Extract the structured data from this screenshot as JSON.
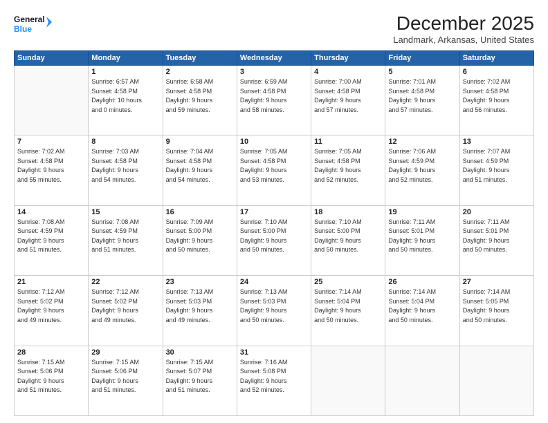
{
  "header": {
    "logo_line1": "General",
    "logo_line2": "Blue",
    "month": "December 2025",
    "location": "Landmark, Arkansas, United States"
  },
  "weekdays": [
    "Sunday",
    "Monday",
    "Tuesday",
    "Wednesday",
    "Thursday",
    "Friday",
    "Saturday"
  ],
  "weeks": [
    [
      {
        "day": "",
        "info": ""
      },
      {
        "day": "1",
        "info": "Sunrise: 6:57 AM\nSunset: 4:58 PM\nDaylight: 10 hours\nand 0 minutes."
      },
      {
        "day": "2",
        "info": "Sunrise: 6:58 AM\nSunset: 4:58 PM\nDaylight: 9 hours\nand 59 minutes."
      },
      {
        "day": "3",
        "info": "Sunrise: 6:59 AM\nSunset: 4:58 PM\nDaylight: 9 hours\nand 58 minutes."
      },
      {
        "day": "4",
        "info": "Sunrise: 7:00 AM\nSunset: 4:58 PM\nDaylight: 9 hours\nand 57 minutes."
      },
      {
        "day": "5",
        "info": "Sunrise: 7:01 AM\nSunset: 4:58 PM\nDaylight: 9 hours\nand 57 minutes."
      },
      {
        "day": "6",
        "info": "Sunrise: 7:02 AM\nSunset: 4:58 PM\nDaylight: 9 hours\nand 56 minutes."
      }
    ],
    [
      {
        "day": "7",
        "info": "Sunrise: 7:02 AM\nSunset: 4:58 PM\nDaylight: 9 hours\nand 55 minutes."
      },
      {
        "day": "8",
        "info": "Sunrise: 7:03 AM\nSunset: 4:58 PM\nDaylight: 9 hours\nand 54 minutes."
      },
      {
        "day": "9",
        "info": "Sunrise: 7:04 AM\nSunset: 4:58 PM\nDaylight: 9 hours\nand 54 minutes."
      },
      {
        "day": "10",
        "info": "Sunrise: 7:05 AM\nSunset: 4:58 PM\nDaylight: 9 hours\nand 53 minutes."
      },
      {
        "day": "11",
        "info": "Sunrise: 7:05 AM\nSunset: 4:58 PM\nDaylight: 9 hours\nand 52 minutes."
      },
      {
        "day": "12",
        "info": "Sunrise: 7:06 AM\nSunset: 4:59 PM\nDaylight: 9 hours\nand 52 minutes."
      },
      {
        "day": "13",
        "info": "Sunrise: 7:07 AM\nSunset: 4:59 PM\nDaylight: 9 hours\nand 51 minutes."
      }
    ],
    [
      {
        "day": "14",
        "info": "Sunrise: 7:08 AM\nSunset: 4:59 PM\nDaylight: 9 hours\nand 51 minutes."
      },
      {
        "day": "15",
        "info": "Sunrise: 7:08 AM\nSunset: 4:59 PM\nDaylight: 9 hours\nand 51 minutes."
      },
      {
        "day": "16",
        "info": "Sunrise: 7:09 AM\nSunset: 5:00 PM\nDaylight: 9 hours\nand 50 minutes."
      },
      {
        "day": "17",
        "info": "Sunrise: 7:10 AM\nSunset: 5:00 PM\nDaylight: 9 hours\nand 50 minutes."
      },
      {
        "day": "18",
        "info": "Sunrise: 7:10 AM\nSunset: 5:00 PM\nDaylight: 9 hours\nand 50 minutes."
      },
      {
        "day": "19",
        "info": "Sunrise: 7:11 AM\nSunset: 5:01 PM\nDaylight: 9 hours\nand 50 minutes."
      },
      {
        "day": "20",
        "info": "Sunrise: 7:11 AM\nSunset: 5:01 PM\nDaylight: 9 hours\nand 50 minutes."
      }
    ],
    [
      {
        "day": "21",
        "info": "Sunrise: 7:12 AM\nSunset: 5:02 PM\nDaylight: 9 hours\nand 49 minutes."
      },
      {
        "day": "22",
        "info": "Sunrise: 7:12 AM\nSunset: 5:02 PM\nDaylight: 9 hours\nand 49 minutes."
      },
      {
        "day": "23",
        "info": "Sunrise: 7:13 AM\nSunset: 5:03 PM\nDaylight: 9 hours\nand 49 minutes."
      },
      {
        "day": "24",
        "info": "Sunrise: 7:13 AM\nSunset: 5:03 PM\nDaylight: 9 hours\nand 50 minutes."
      },
      {
        "day": "25",
        "info": "Sunrise: 7:14 AM\nSunset: 5:04 PM\nDaylight: 9 hours\nand 50 minutes."
      },
      {
        "day": "26",
        "info": "Sunrise: 7:14 AM\nSunset: 5:04 PM\nDaylight: 9 hours\nand 50 minutes."
      },
      {
        "day": "27",
        "info": "Sunrise: 7:14 AM\nSunset: 5:05 PM\nDaylight: 9 hours\nand 50 minutes."
      }
    ],
    [
      {
        "day": "28",
        "info": "Sunrise: 7:15 AM\nSunset: 5:06 PM\nDaylight: 9 hours\nand 51 minutes."
      },
      {
        "day": "29",
        "info": "Sunrise: 7:15 AM\nSunset: 5:06 PM\nDaylight: 9 hours\nand 51 minutes."
      },
      {
        "day": "30",
        "info": "Sunrise: 7:15 AM\nSunset: 5:07 PM\nDaylight: 9 hours\nand 51 minutes."
      },
      {
        "day": "31",
        "info": "Sunrise: 7:16 AM\nSunset: 5:08 PM\nDaylight: 9 hours\nand 52 minutes."
      },
      {
        "day": "",
        "info": ""
      },
      {
        "day": "",
        "info": ""
      },
      {
        "day": "",
        "info": ""
      }
    ]
  ]
}
